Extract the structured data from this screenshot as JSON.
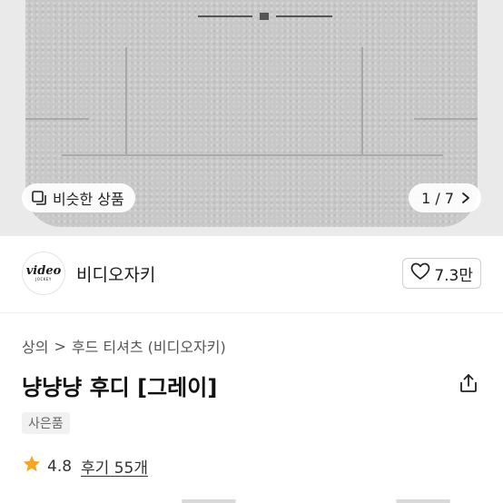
{
  "gallery": {
    "similar_label": "비슷한 상품",
    "counter": "1 / 7",
    "similar_icon": "similar-products-icon",
    "next_icon": "chevron-right-icon"
  },
  "seller": {
    "name": "비디오자키",
    "logo_text": "video",
    "logo_subtext": "JOCKEY",
    "likes": "7.3만",
    "like_icon": "heart-outline-icon"
  },
  "breadcrumb": {
    "level1": "상의",
    "separator": ">",
    "level2": "후드 티셔츠 (비디오자키)"
  },
  "product": {
    "title": "냥냥냥 후디 [그레이]",
    "badge": "사은품",
    "rating": "4.8",
    "reviews": "후기 55개",
    "share_icon": "share-icon",
    "star_color": "#f5a623"
  },
  "colors": {
    "hoodie": "#c8c8c8",
    "text": "#1a1a1a"
  }
}
